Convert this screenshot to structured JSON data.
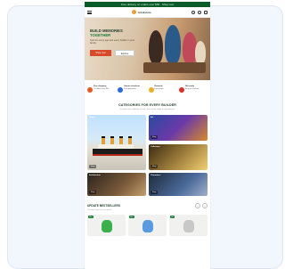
{
  "promo_bar": {
    "text": "Free delivery on orders over $50 · Shop now"
  },
  "header": {
    "brand": "brickstore",
    "icons": [
      "menu-icon",
      "search-icon",
      "account-icon",
      "cart-icon"
    ]
  },
  "hero": {
    "title_line1": "BUILD MEMORIES",
    "title_highlight": "TOGETHER",
    "subtitle": "Sets for every age and every builder in your family.",
    "primary_button": "Shop now",
    "secondary_button": "Explore"
  },
  "usps": [
    {
      "title": "Free shipping",
      "text": "On orders over $50",
      "color": "#e05a2a"
    },
    {
      "title": "Secure checkout",
      "text": "Safe payments",
      "color": "#2a6ad8"
    },
    {
      "title": "Rewards",
      "text": "Earn points",
      "color": "#e8b02a"
    },
    {
      "title": "Gift ready",
      "text": "Wrap at checkout",
      "color": "#d8302a"
    }
  ],
  "categories": {
    "title": "CATEGORIES FOR EVERY BUILDER",
    "subtitle": "Discover our collection of sets, from iconic ships to colourful art.",
    "tiles": [
      {
        "label": "Ships",
        "button": "Shop"
      },
      {
        "label": "Art",
        "button": "Shop"
      },
      {
        "label": "Collectors",
        "button": "Shop"
      },
      {
        "label": "Architecture",
        "button": "Shop"
      },
      {
        "label": "Characters",
        "button": "Shop"
      }
    ]
  },
  "bestsellers": {
    "title": "UPDATE BESTSELLERS",
    "subtitle": "Our most loved sets this month",
    "prev": "‹",
    "next": "›",
    "cards": [
      {
        "badge": "New",
        "color": "#3ab04a"
      },
      {
        "badge": "New",
        "color": "#5a9ae0"
      },
      {
        "badge": "Hot",
        "color": "#c8c8c8"
      }
    ]
  }
}
